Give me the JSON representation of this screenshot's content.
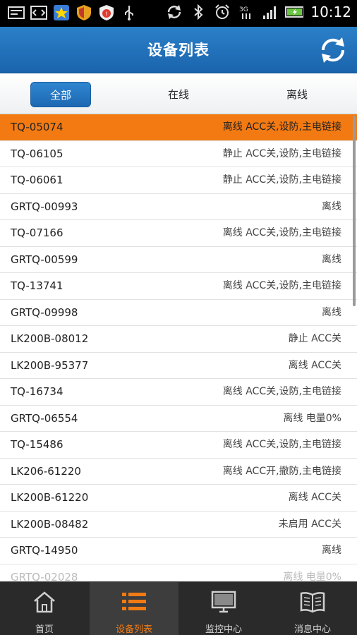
{
  "status_bar": {
    "time": "10:12"
  },
  "header": {
    "title": "设备列表"
  },
  "tabs": [
    {
      "label": "全部"
    },
    {
      "label": "在线"
    },
    {
      "label": "离线"
    }
  ],
  "devices": [
    {
      "name": "TQ-05074",
      "status": "离线 ACC关,设防,主电链接"
    },
    {
      "name": "TQ-06105",
      "status": "静止 ACC关,设防,主电链接"
    },
    {
      "name": "TQ-06061",
      "status": "静止 ACC关,设防,主电链接"
    },
    {
      "name": "GRTQ-00993",
      "status": "离线"
    },
    {
      "name": "TQ-07166",
      "status": "离线 ACC关,设防,主电链接"
    },
    {
      "name": "GRTQ-00599",
      "status": "离线"
    },
    {
      "name": "TQ-13741",
      "status": "离线 ACC关,设防,主电链接"
    },
    {
      "name": "GRTQ-09998",
      "status": "离线"
    },
    {
      "name": "LK200B-08012",
      "status": "静止 ACC关"
    },
    {
      "name": "LK200B-95377",
      "status": "离线 ACC关"
    },
    {
      "name": "TQ-16734",
      "status": "离线 ACC关,设防,主电链接"
    },
    {
      "name": "GRTQ-06554",
      "status": "离线 电量0%"
    },
    {
      "name": "TQ-15486",
      "status": "离线 ACC关,设防,主电链接"
    },
    {
      "name": "LK206-61220",
      "status": "离线 ACC开,撤防,主电链接"
    },
    {
      "name": "LK200B-61220",
      "status": "离线 ACC关"
    },
    {
      "name": "LK200B-08482",
      "status": "未启用 ACC关"
    },
    {
      "name": "GRTQ-14950",
      "status": "离线"
    },
    {
      "name": "GRTQ-02028",
      "status": "离线 电量0%"
    }
  ],
  "bottom_nav": [
    {
      "label": "首页",
      "icon": "home-icon"
    },
    {
      "label": "设备列表",
      "icon": "list-icon"
    },
    {
      "label": "监控中心",
      "icon": "monitor-icon"
    },
    {
      "label": "消息中心",
      "icon": "book-icon"
    }
  ],
  "colors": {
    "accent": "#f37a12",
    "header": "#1f6eb8",
    "nav_bg": "#2a2a2a"
  }
}
